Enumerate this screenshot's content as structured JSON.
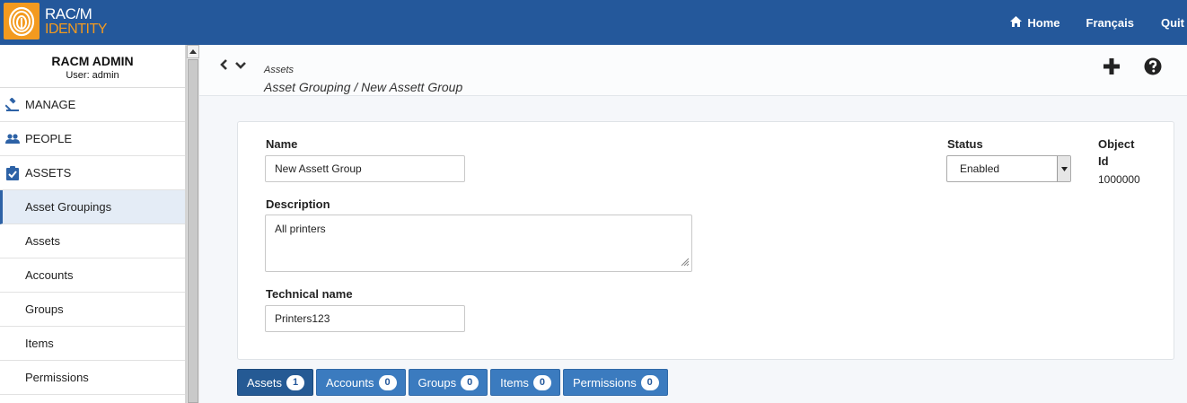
{
  "app": {
    "logo_line1": "RAC/M",
    "logo_line2": "IDENTITY",
    "brand_color": "#24589b",
    "accent_color": "#f39a1f"
  },
  "topnav": {
    "home": {
      "label": "Home",
      "icon": "home-icon"
    },
    "language": {
      "label": "Français"
    },
    "quit": {
      "label": "Quit"
    }
  },
  "sidebar": {
    "user_title": "RACM ADMIN",
    "user_subtitle": "User: admin",
    "sections": [
      {
        "label": "MANAGE",
        "icon": "gavel-icon"
      },
      {
        "label": "PEOPLE",
        "icon": "people-icon"
      },
      {
        "label": "ASSETS",
        "icon": "clipboard-check-icon"
      }
    ],
    "items": [
      {
        "label": "Asset Groupings",
        "active": true
      },
      {
        "label": "Assets"
      },
      {
        "label": "Accounts"
      },
      {
        "label": "Groups"
      },
      {
        "label": "Items"
      },
      {
        "label": "Permissions"
      }
    ]
  },
  "breadcrumb": {
    "parent": "Assets",
    "current": "Asset Grouping / New Assett Group"
  },
  "form": {
    "name_label": "Name",
    "name_value": "New Assett Group",
    "description_label": "Description",
    "description_value": "All printers",
    "technical_name_label": "Technical name",
    "technical_name_value": "Printers123",
    "status_label": "Status",
    "status_value": "Enabled",
    "object_id_label_1": "Object",
    "object_id_label_2": "Id",
    "object_id_value": "1000000"
  },
  "tabs": [
    {
      "label": "Assets",
      "count": "1",
      "active": true
    },
    {
      "label": "Accounts",
      "count": "0"
    },
    {
      "label": "Groups",
      "count": "0"
    },
    {
      "label": "Items",
      "count": "0"
    },
    {
      "label": "Permissions",
      "count": "0"
    }
  ]
}
